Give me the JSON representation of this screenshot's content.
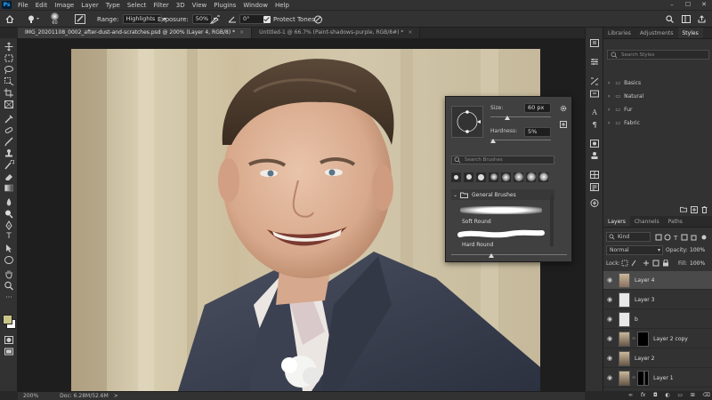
{
  "menu": {
    "app_badge": "Ps",
    "items": [
      "File",
      "Edit",
      "Image",
      "Layer",
      "Type",
      "Select",
      "Filter",
      "3D",
      "View",
      "Plugins",
      "Window",
      "Help"
    ],
    "window_controls": [
      "–",
      "☐",
      "✕"
    ]
  },
  "options": {
    "brush_size": "60",
    "range_label": "Range:",
    "range_value": "Highlights",
    "exposure_label": "Exposure:",
    "exposure_value": "50%",
    "angle_value": "0°",
    "protect_tones": "Protect Tones"
  },
  "tabs": [
    {
      "label": "IMG_20201108_0002_after-dust-and-scratches.psd @ 200% (Layer 4, RGB/8) *",
      "close": "×"
    },
    {
      "label": "Untitled-1 @ 66.7% (Paint-shadows-purple, RGB/8#) *",
      "close": "×"
    }
  ],
  "status": {
    "zoom": "200%",
    "doc": "Doc: 6.28M/52.6M",
    "arrow": ">"
  },
  "brush_popup": {
    "size_label": "Size:",
    "size_value": "60 px",
    "hardness_label": "Hardness:",
    "hardness_value": "5%",
    "search_placeholder": "Search Brushes",
    "folder": "General Brushes",
    "brush1": "Soft Round",
    "brush2": "Hard Round"
  },
  "styles_panel": {
    "tabs": [
      "Libraries",
      "Adjustments",
      "Styles"
    ],
    "search_placeholder": "Search Styles",
    "folders": [
      "Basics",
      "Natural",
      "Fur",
      "Fabric"
    ]
  },
  "layers_panel": {
    "tabs": [
      "Layers",
      "Channels",
      "Paths"
    ],
    "kind": "Kind",
    "blend_mode": "Normal",
    "opacity_label": "Opacity:",
    "opacity_value": "100%",
    "lock_label": "Lock:",
    "fill_label": "Fill:",
    "fill_value": "100%",
    "layers": [
      {
        "name": "Layer 4",
        "selected": true
      },
      {
        "name": "Layer 3",
        "selected": false
      },
      {
        "name": "b",
        "selected": false
      },
      {
        "name": "Layer 2 copy",
        "selected": false
      },
      {
        "name": "Layer 2",
        "selected": false
      },
      {
        "name": "Layer 1",
        "selected": false
      }
    ],
    "footer_icons": [
      "link-icon",
      "fx-icon",
      "mask-icon",
      "adjustment-icon",
      "group-icon",
      "new-layer-icon",
      "trash-icon"
    ]
  },
  "colors": {
    "foreground": "#c9c587",
    "background": "#ffffff",
    "accent": "#31a8ff"
  }
}
